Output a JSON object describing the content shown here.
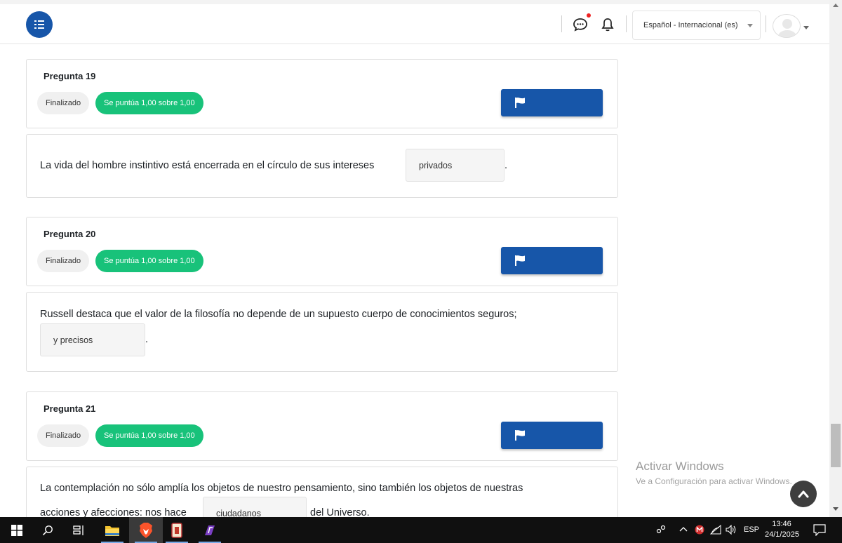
{
  "navbar": {
    "drawer_icon": "drawer-toggle-icon",
    "message_icon": "chat-bubble-icon",
    "notification_icon": "bell-icon",
    "language": "Español - Internacional (es)",
    "avatar_icon": "user-avatar-icon",
    "accent_color": "#1756a9",
    "unread_dot_color": "#e22222"
  },
  "questions": [
    {
      "title": "Pregunta 19",
      "state": "Finalizado",
      "grade": "Se puntúa 1,00 sobre 1,00",
      "flag_icon": "flag-icon",
      "text_before": "La vida del hombre instintivo está encerrada en el círculo de sus intereses",
      "answer": "privados",
      "text_after": "."
    },
    {
      "title": "Pregunta 20",
      "state": "Finalizado",
      "grade": "Se puntúa 1,00 sobre 1,00",
      "flag_icon": "flag-icon",
      "text_before": "Russell destaca que el valor de la filosofía no depende de un supuesto cuerpo de conocimientos seguros;",
      "answer": "y precisos",
      "text_after": "."
    },
    {
      "title": "Pregunta 21",
      "state": "Finalizado",
      "grade": "Se puntúa 1,00 sobre 1,00",
      "flag_icon": "flag-icon",
      "text_line1": "La contemplación no sólo amplía los objetos de nuestro pensamiento, sino también los objetos de nuestras",
      "text_before": "acciones y afecciones: nos hace",
      "answer": "ciudadanos",
      "text_after": "del Universo."
    }
  ],
  "grade_badge_color": "#18c27a",
  "watermark": {
    "title": "Activar Windows",
    "subtitle": "Ve a Configuración para activar Windows."
  },
  "back_to_top_icon": "arrow-up-icon",
  "taskbar": {
    "apps": [
      "windows-start-icon",
      "search-icon",
      "task-view-icon",
      "file-explorer-icon",
      "brave-browser-icon",
      "app-icon-cards",
      "app-icon-purple"
    ],
    "tray_language": "ESP",
    "time": "13:46",
    "date": "24/1/2025",
    "notification_icon": "action-center-icon"
  }
}
